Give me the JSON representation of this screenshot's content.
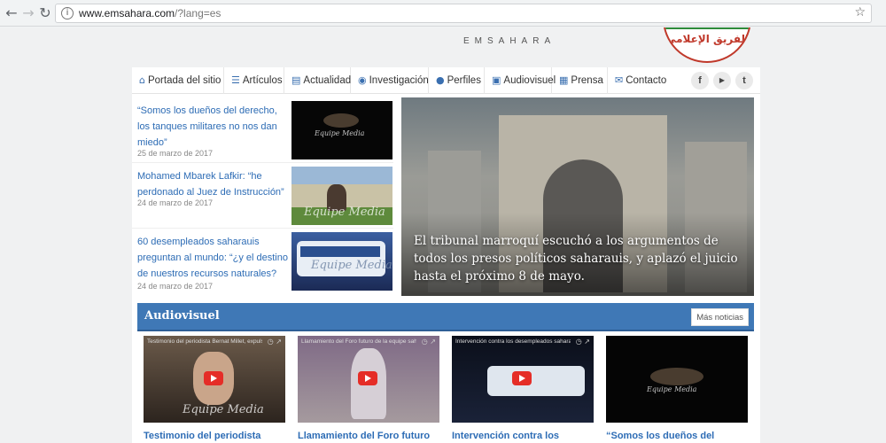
{
  "browser": {
    "url_host": "www.emsahara.com",
    "url_path": "/?lang=es",
    "back_icon": "arrow-left",
    "forward_icon": "arrow-right",
    "reload_icon": "reload",
    "star_icon": "star"
  },
  "site": {
    "tagline": "EMSAHARA",
    "logo_text": "الفريق الإعلامي"
  },
  "nav": {
    "items": [
      {
        "icon": "home-icon",
        "label": "Portada del sitio"
      },
      {
        "icon": "list-icon",
        "label": "Artículos"
      },
      {
        "icon": "doc-icon",
        "label": "Actualidad"
      },
      {
        "icon": "target-icon",
        "label": "Investigación"
      },
      {
        "icon": "user-icon",
        "label": "Perfiles"
      },
      {
        "icon": "film-icon",
        "label": "Audiovisuel"
      },
      {
        "icon": "newspaper-icon",
        "label": "Prensa"
      },
      {
        "icon": "mail-icon",
        "label": "Contacto"
      }
    ],
    "social": [
      {
        "icon": "facebook-icon",
        "label": "f"
      },
      {
        "icon": "youtube-icon",
        "label": "▶"
      },
      {
        "icon": "twitter-icon",
        "label": "t"
      }
    ]
  },
  "news": [
    {
      "title": "“Somos los dueños del derecho, los tanques militares no nos dan miedo”",
      "date": "25 de marzo de 2017"
    },
    {
      "title": "Mohamed Mbarek Lafkir: “he perdonado al Juez de Instrucción”",
      "date": "24 de marzo de 2017"
    },
    {
      "title": "60 desempleados saharauis preguntan al mundo: “¿y el destino de nuestros recursos naturales?",
      "date": "24 de marzo de 2017"
    }
  ],
  "watermark": "Equipe Media",
  "hero": {
    "caption": "El tribunal marroquí escuchó a los argumentos de todos los presos políticos saharauis, y aplazó el juicio hasta el próximo 8 de mayo."
  },
  "audiovisuel": {
    "title": "Audiovisuel",
    "more_label": "Más noticias",
    "videos": [
      {
        "overlay": "Testimonio del periodista Bernat Millet, expuls...",
        "title": "Testimonio del periodista"
      },
      {
        "overlay": "Llamamiento del Foro futuro de la equipe sahar...",
        "title": "Llamamiento del Foro futuro"
      },
      {
        "overlay": "Intervención contra los desempleados sahara...",
        "title": "Intervención contra los"
      },
      {
        "overlay": "",
        "title": "“Somos los dueños del"
      }
    ]
  }
}
